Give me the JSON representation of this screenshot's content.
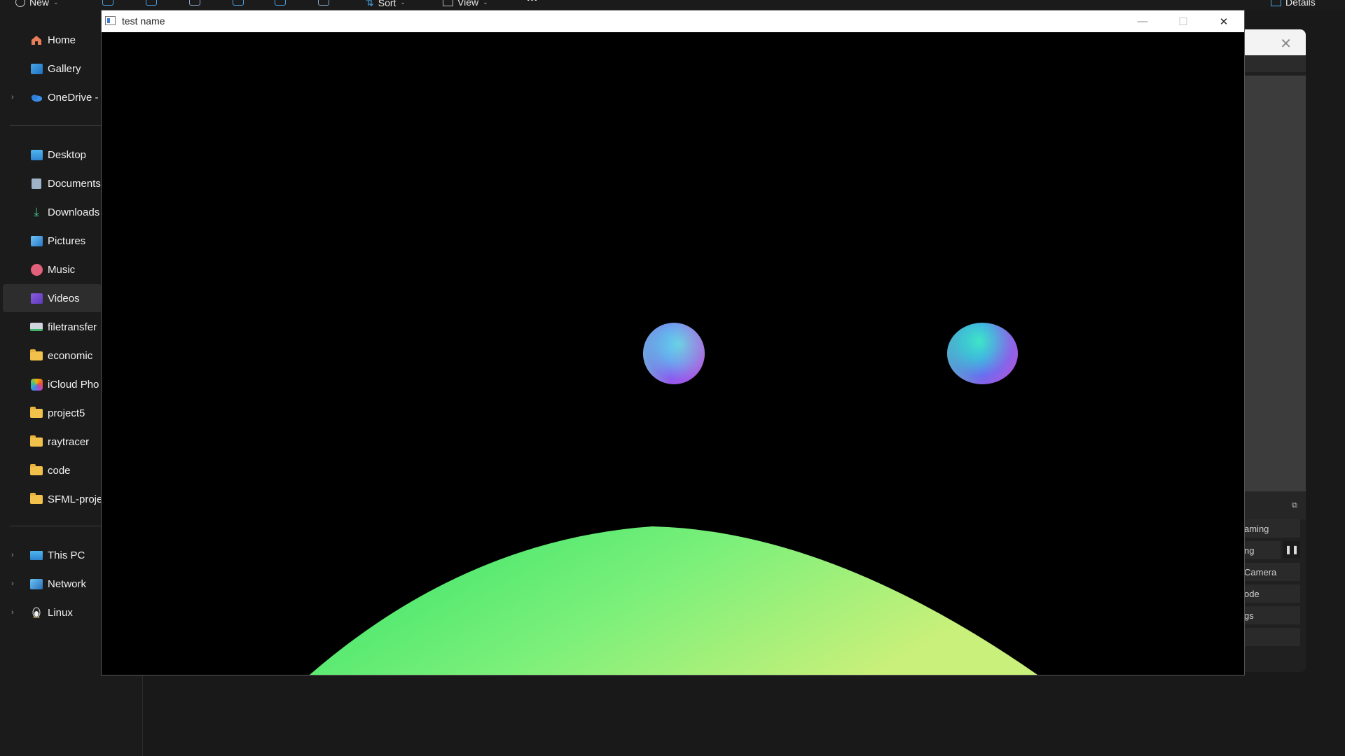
{
  "toolbar": {
    "new_label": "New",
    "sort_label": "Sort",
    "view_label": "View",
    "more_label": "···",
    "details_label": "Details"
  },
  "sidebar": {
    "quick": [
      {
        "label": "Home",
        "icon": "home-icon"
      },
      {
        "label": "Gallery",
        "icon": "gallery-icon"
      },
      {
        "label": "OneDrive -",
        "icon": "onedrive-icon"
      }
    ],
    "pinned": [
      {
        "label": "Desktop",
        "icon": "desktop-icon"
      },
      {
        "label": "Documents",
        "icon": "documents-icon"
      },
      {
        "label": "Downloads",
        "icon": "downloads-icon"
      },
      {
        "label": "Pictures",
        "icon": "pictures-icon"
      },
      {
        "label": "Music",
        "icon": "music-icon"
      },
      {
        "label": "Videos",
        "icon": "videos-icon",
        "selected": true
      },
      {
        "label": "filetransfer",
        "icon": "drive-icon"
      },
      {
        "label": "economic",
        "icon": "folder-icon"
      },
      {
        "label": "iCloud Pho",
        "icon": "icloud-photos-icon"
      },
      {
        "label": "project5",
        "icon": "folder-icon"
      },
      {
        "label": "raytracer",
        "icon": "folder-icon"
      },
      {
        "label": "code",
        "icon": "folder-icon"
      },
      {
        "label": "SFML-proje",
        "icon": "folder-icon"
      }
    ],
    "devices": [
      {
        "label": "This PC",
        "icon": "pc-icon"
      },
      {
        "label": "Network",
        "icon": "network-icon"
      },
      {
        "label": "Linux",
        "icon": "linux-icon"
      }
    ]
  },
  "side_panel": {
    "buttons": [
      "aming",
      "ng",
      "Camera",
      "ode",
      "gs",
      ""
    ],
    "pause_symbol": "❚❚"
  },
  "window": {
    "title": "test name",
    "minimize": "—",
    "maximize": "☐",
    "close": "✕"
  },
  "scene": {
    "sphere_colors": [
      "#5fe0e6",
      "#8a5cf0",
      "#c24fd6"
    ],
    "ground_colors": [
      "#33e36a",
      "#7cf07a",
      "#c8f07a"
    ]
  }
}
